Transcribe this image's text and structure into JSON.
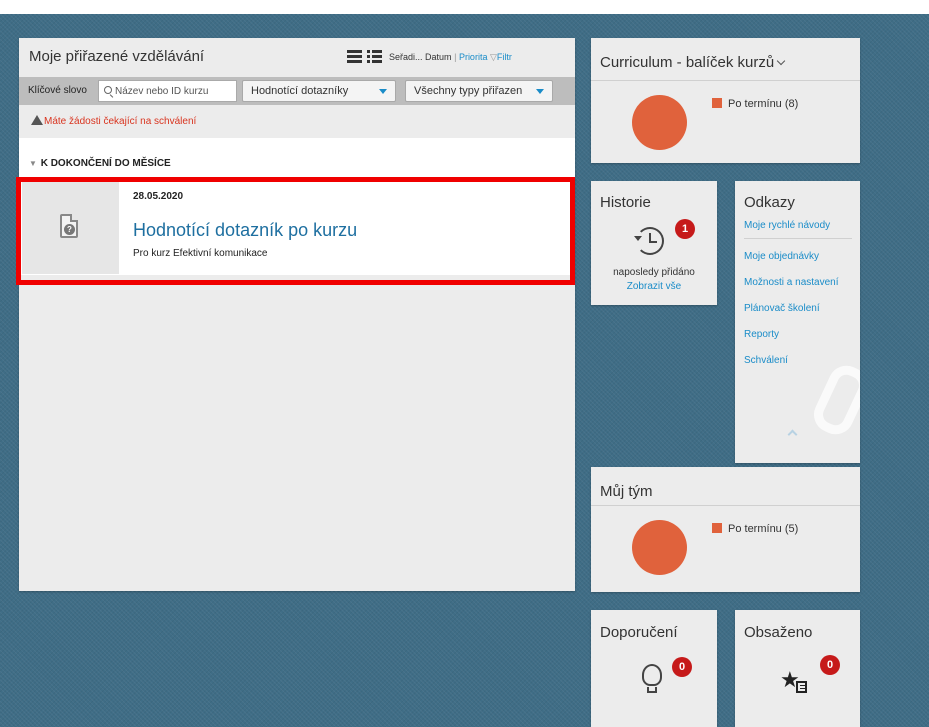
{
  "learning": {
    "title": "Moje přiřazené vzdělávání",
    "sort_label": "Seřadi...",
    "sort_date": "Datum",
    "sort_priority": "Priorita",
    "filter_label": "Filtr",
    "keyword_label": "Klíčové slovo",
    "search_placeholder": "Název nebo ID kurzu",
    "type_dropdown": "Hodnotící dotazníky",
    "assign_dropdown": "Všechny typy přiřazen",
    "warning": "Máte žádosti čekající na schválení",
    "section_title": "K DOKONČENÍ DO MĚSÍCE",
    "course": {
      "date": "28.05.2020",
      "title": "Hodnotící dotazník po kurzu",
      "subtitle": "Pro kurz Efektivní komunikace"
    }
  },
  "curriculum": {
    "title": "Curriculum - balíček kurzů",
    "legend": "Po termínu (8)",
    "color": "#e0623c"
  },
  "history": {
    "title": "Historie",
    "badge": "1",
    "recent_label": "naposledy přidáno",
    "view_all": "Zobrazit vše"
  },
  "links": {
    "title": "Odkazy",
    "items": [
      "Moje rychlé návody",
      "Moje objednávky",
      "Možnosti a nastavení",
      "Plánovač školení",
      "Reporty",
      "Schválení"
    ]
  },
  "team": {
    "title": "Můj tým",
    "legend": "Po termínu (5)",
    "color": "#e0623c"
  },
  "recommend": {
    "title": "Doporučení",
    "badge": "0"
  },
  "contained": {
    "title": "Obsaženo",
    "badge": "0"
  },
  "colors": {
    "link": "#1a8cc8",
    "badge": "#c61a1a",
    "warning": "#d9341f",
    "highlight": "#f00000"
  }
}
